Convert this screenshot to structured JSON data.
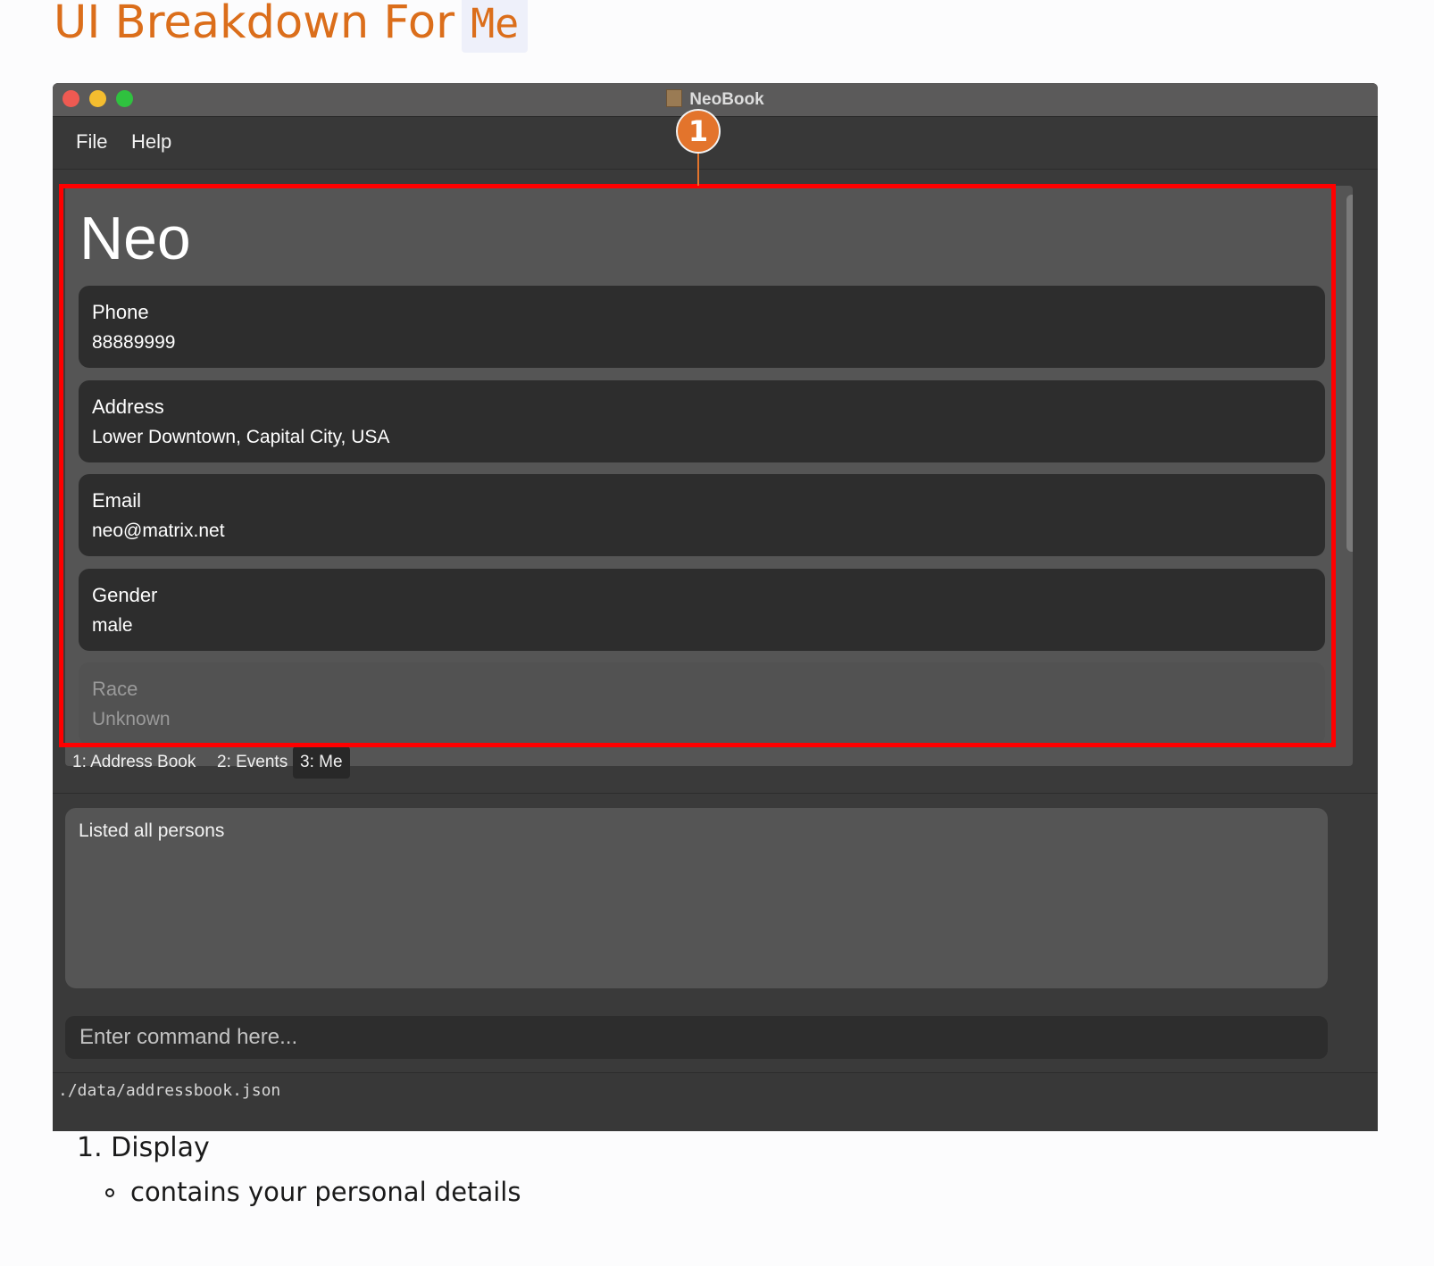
{
  "doc": {
    "title": "UI Breakdown For",
    "title_code": "Me",
    "notes": [
      {
        "number": "1.",
        "label": "Display",
        "details": [
          "contains your personal details"
        ]
      }
    ]
  },
  "window": {
    "title": "NeoBook",
    "menu": [
      "File",
      "Help"
    ]
  },
  "annotation": {
    "badge": "1",
    "color": "#e3742c",
    "highlight_color": "#ff0000"
  },
  "display": {
    "name": "Neo",
    "fields": [
      {
        "label": "Phone",
        "value": "88889999"
      },
      {
        "label": "Address",
        "value": "Lower Downtown, Capital City, USA"
      },
      {
        "label": "Email",
        "value": "neo@matrix.net"
      },
      {
        "label": "Gender",
        "value": "male"
      },
      {
        "label": "Race",
        "value": "Unknown"
      }
    ]
  },
  "tabs": [
    {
      "label": "1: Address Book",
      "active": false
    },
    {
      "label": "2: Events",
      "active": false
    },
    {
      "label": "3: Me",
      "active": true
    }
  ],
  "result": {
    "text": "Listed all persons"
  },
  "command": {
    "placeholder": "Enter command here..."
  },
  "status": {
    "path": "./data/addressbook.json"
  }
}
